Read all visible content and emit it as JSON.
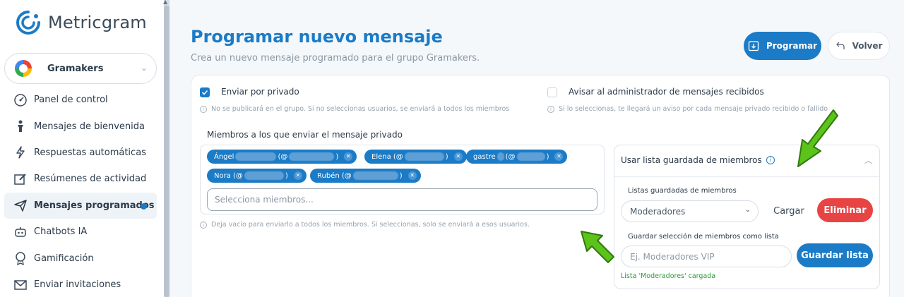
{
  "brand": {
    "name": "Metricgram"
  },
  "group": {
    "name": "Gramakers"
  },
  "nav": [
    {
      "label": "Panel de control",
      "icon": "gauge-icon",
      "active": false
    },
    {
      "label": "Mensajes de bienvenida",
      "icon": "person-icon",
      "active": false
    },
    {
      "label": "Respuestas automáticas",
      "icon": "bolt-icon",
      "active": false
    },
    {
      "label": "Resúmenes de actividad",
      "icon": "edit-icon",
      "active": false
    },
    {
      "label": "Mensajes programados",
      "icon": "send-icon",
      "active": true
    },
    {
      "label": "Chatbots IA",
      "icon": "robot-icon",
      "active": false
    },
    {
      "label": "Gamificación",
      "icon": "medal-icon",
      "active": false
    },
    {
      "label": "Enviar invitaciones",
      "icon": "envelope-icon",
      "active": false
    }
  ],
  "header": {
    "title": "Programar nuevo mensaje",
    "subtitle": "Crea un nuevo mensaje programado para el grupo Gramakers.",
    "schedule_button": "Programar",
    "back_button": "Volver"
  },
  "options": {
    "private": {
      "label": "Enviar por privado",
      "checked": true,
      "hint": "No se publicará en el grupo. Si no seleccionas usuarios, se enviará a todos los miembros"
    },
    "notify_admin": {
      "label": "Avisar al administrador de mensajes recibidos",
      "checked": false,
      "hint": "Si lo seleccionas, te llegará un aviso por cada mensaje privado recibido o fallido"
    }
  },
  "members": {
    "label": "Miembros a los que enviar el mensaje privado",
    "chips": [
      {
        "prefix": "Ángel",
        "mid": "(@",
        "suffix": ")"
      },
      {
        "prefix": "Elena (@",
        "mid": "",
        "suffix": ")"
      },
      {
        "prefix": "gastre",
        "mid": "(@",
        "suffix": ")"
      },
      {
        "prefix": "Nora (@",
        "mid": "",
        "suffix": ")"
      },
      {
        "prefix": "Rubén (@",
        "mid": "",
        "suffix": ")"
      }
    ],
    "placeholder": "Selecciona miembros...",
    "hint": "Deja vacío para enviarlo a todos los miembros. Si seleccionas, solo se enviará a esos usuarios."
  },
  "saved_lists": {
    "title": "Usar lista guardada de miembros",
    "lists_label": "Listas guardadas de miembros",
    "selected_list": "Moderadores",
    "load_button": "Cargar",
    "delete_button": "Eliminar",
    "save_label": "Guardar selección de miembros como lista",
    "save_placeholder": "Ej. Moderadores VIP",
    "save_button": "Guardar lista",
    "status": "Lista 'Moderadores' cargada"
  },
  "colors": {
    "accent": "#1b7bc6",
    "danger": "#e84444",
    "success": "#2e9a3b",
    "annotation_arrow": "#5cc31a"
  }
}
